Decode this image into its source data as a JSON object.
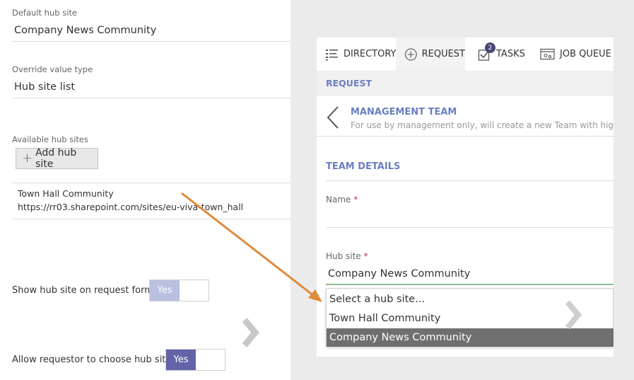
{
  "settings": {
    "default_hub_label": "Default hub site",
    "default_hub_value": "Company News Community",
    "override_label": "Override value type",
    "override_value": "Hub site list",
    "available_label": "Available hub sites",
    "add_button_label": "Add hub site",
    "hub_sites": [
      {
        "name": "Town Hall Community",
        "url": "https://rr03.sharepoint.com/sites/eu-viva-town_hall"
      }
    ],
    "show_on_form_label": "Show hub site on request form",
    "show_on_form_toggle": "Yes",
    "allow_choose_label": "Allow requestor to choose hub site",
    "allow_choose_toggle": "Yes"
  },
  "colors": {
    "accent": "#6b7fc0",
    "toggle_faded": "#b9c0e0",
    "toggle_active": "#6264a7",
    "badge": "#464775",
    "arrow": "#e08a3a",
    "selected_option": "#6f6f6f"
  },
  "app": {
    "tabs": [
      {
        "label": "DIRECTORY",
        "icon": "list-icon"
      },
      {
        "label": "REQUEST",
        "icon": "plus-circle-icon"
      },
      {
        "label": "TASKS",
        "icon": "checkbox-icon",
        "badge": "2"
      },
      {
        "label": "JOB QUEUE",
        "icon": "job-queue-icon"
      }
    ],
    "active_tab": "REQUEST",
    "section_header": "REQUEST",
    "template_title": "MANAGEMENT TEAM",
    "template_desc": "For use by management only, will create a new Team with high secur",
    "details_title": "TEAM DETAILS",
    "name_label": "Name",
    "hub_label": "Hub site",
    "required_mark": "*",
    "hub_value": "Company News Community",
    "dropdown_options": [
      "Select a hub site...",
      "Town Hall Community",
      "Company News Community"
    ],
    "selected_option_index": 2
  }
}
